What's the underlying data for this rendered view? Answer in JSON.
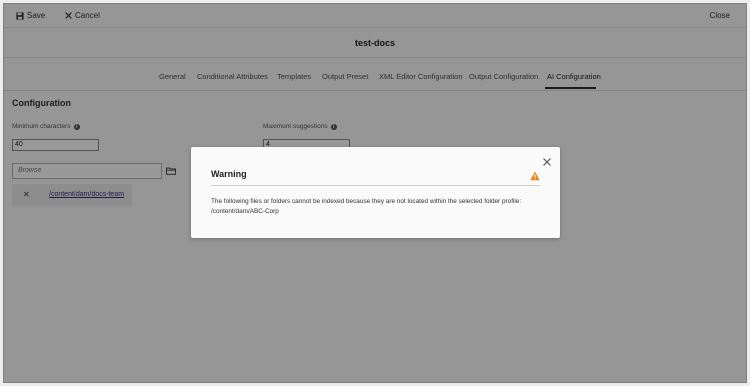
{
  "toolbar": {
    "save_label": "Save",
    "cancel_label": "Cancel",
    "close_label": "Close"
  },
  "page_title": "test-docs",
  "tabs": [
    {
      "label": "General",
      "active": false
    },
    {
      "label": "Conditional Attributes",
      "active": false
    },
    {
      "label": "Templates",
      "active": false
    },
    {
      "label": "Output Preset",
      "active": false
    },
    {
      "label": "XML Editor Configuration",
      "active": false
    },
    {
      "label": "Output Configuration",
      "active": false
    },
    {
      "label": "AI Configuration",
      "active": true
    }
  ],
  "configuration": {
    "section_title": "Configuration",
    "min_chars": {
      "label": "Minimum characters",
      "value": "40"
    },
    "max_suggestions": {
      "label": "Maximum suggestions",
      "value": "4"
    },
    "browse_placeholder": "Browse",
    "selected_paths": [
      "/content/dam/docs-team"
    ]
  },
  "dialog": {
    "title": "Warning",
    "message_line1": "The following files or folders cannot be indexed because they are not located within the selected folder profile:",
    "message_line2": "/content/dam/ABC-Corp"
  },
  "colors": {
    "warning_icon": "#e68619",
    "active_tab_underline": "#2c2c2c",
    "link": "#3d2c7a",
    "overlay": "rgba(0,0,0,0.40)"
  }
}
